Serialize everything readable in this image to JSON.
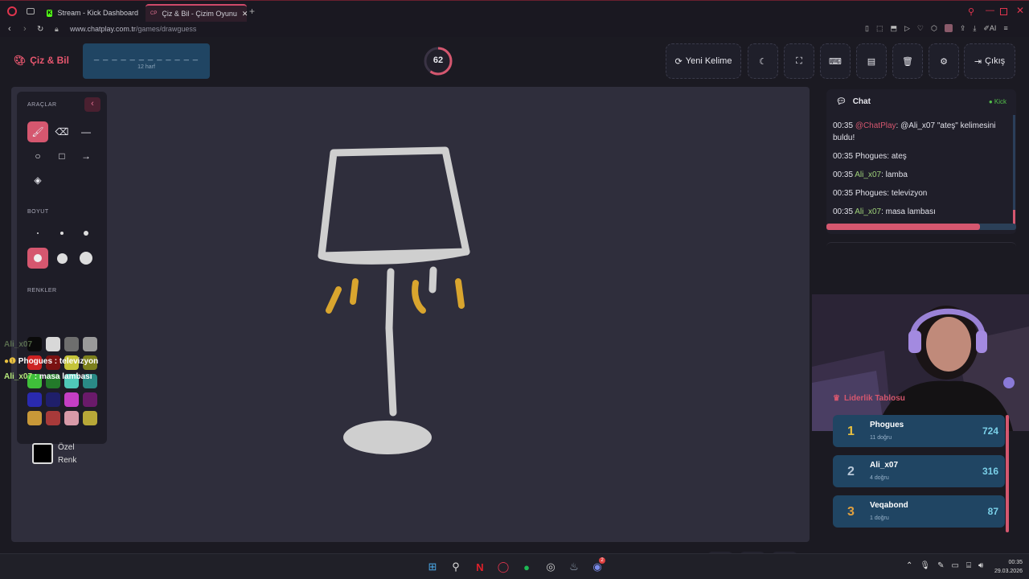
{
  "browser": {
    "tabs": [
      {
        "label": "Stream - Kick Dashboard",
        "icon": "kick-icon"
      },
      {
        "label": "Çiz & Bil - Çizim Oyunu",
        "icon": "chatplay-icon"
      }
    ],
    "url_host": "www.chatplay.com.tr",
    "url_path": "/games/drawguess",
    "ai_label": "AI"
  },
  "header": {
    "logo": "Çiz & Bil",
    "word_mask": "_ _ _ _ _ _ _ _ _ _ _ _",
    "word_hint": "12 harf",
    "timer": "62",
    "timer_fraction": 0.6,
    "new_word": "Yeni Kelime",
    "exit": "Çıkış"
  },
  "toolbox": {
    "tools_label": "ARAÇLAR",
    "size_label": "BOYUT",
    "colors_label": "RENKLER",
    "custom_color_line1": "Özel",
    "custom_color_line2": "Renk",
    "colors": [
      "#0a0a0a",
      "#d8d8d8",
      "#6e6e6e",
      "#9a9a9a",
      "#cc2222",
      "#7a1212",
      "#c5c43a",
      "#7c801d",
      "#3fbf3a",
      "#237a2a",
      "#4fc8b8",
      "#2a8a86",
      "#2a2ab0",
      "#1f1f6a",
      "#c43ec4",
      "#6a1a6a",
      "#c89838",
      "#a83a3a",
      "#d89aa8",
      "#b8a838"
    ]
  },
  "overlay_chat": [
    {
      "user": "Ali_x07",
      "text": ""
    },
    {
      "user": "Phogues",
      "text": "televizyon"
    },
    {
      "user": "Ali_x07",
      "text": "masa lambası"
    }
  ],
  "chat": {
    "title": "Chat",
    "platform": "Kick",
    "messages": [
      {
        "time": "00:35",
        "user": "@ChatPlay",
        "sep": ":",
        "text": "@Ali_x07 \"ateş\" kelimesini buldu!",
        "user_color": "#d5576f"
      },
      {
        "time": "00:35",
        "user": "Phogues",
        "sep": ":",
        "text": "ateş",
        "user_color": "#e2e2ea"
      },
      {
        "time": "00:35",
        "user": "Ali_x07",
        "sep": ":",
        "text": "lamba",
        "user_color": "#9fd27a"
      },
      {
        "time": "00:35",
        "user": "Phogues",
        "sep": ":",
        "text": "televizyon",
        "user_color": "#e2e2ea"
      },
      {
        "time": "00:35",
        "user": "Ali_x07",
        "sep": ":",
        "text": "masa lambası",
        "user_color": "#9fd27a"
      }
    ]
  },
  "leaderboard": {
    "title": "Liderlik Tablosu",
    "rows": [
      {
        "rank": "1",
        "name": "Phogues",
        "sub": "11 doğru",
        "score": "724"
      },
      {
        "rank": "2",
        "name": "Ali_x07",
        "sub": "4 doğru",
        "score": "316"
      },
      {
        "rank": "3",
        "name": "Veqabond",
        "sub": "1 doğru",
        "score": "87"
      }
    ]
  },
  "taskbar": {
    "time": "00:35",
    "date": "29.03.2026",
    "discord_badge": "2"
  }
}
